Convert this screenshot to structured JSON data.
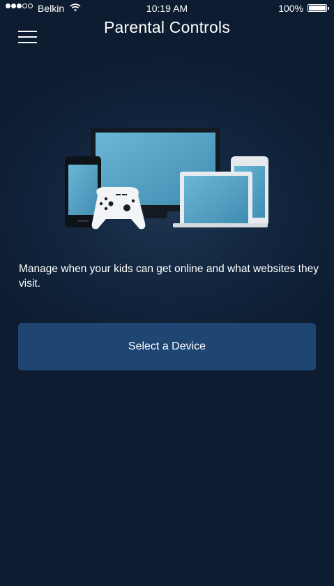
{
  "status_bar": {
    "carrier": "Belkin",
    "time": "10:19 AM",
    "battery": "100%",
    "signal_bars_filled": 3,
    "signal_bars_total": 5
  },
  "header": {
    "title": "Parental Controls",
    "menu_icon": "hamburger-menu-icon"
  },
  "illustration": {
    "items": [
      "tv",
      "phone",
      "game-controller",
      "laptop",
      "tablet"
    ]
  },
  "main": {
    "description": "Manage when your kids can get online and what websites they visit.",
    "select_device_label": "Select a Device"
  },
  "colors": {
    "background": "#0d1c30",
    "button": "#1f4573",
    "screen_accent": "#5aa6c8"
  }
}
